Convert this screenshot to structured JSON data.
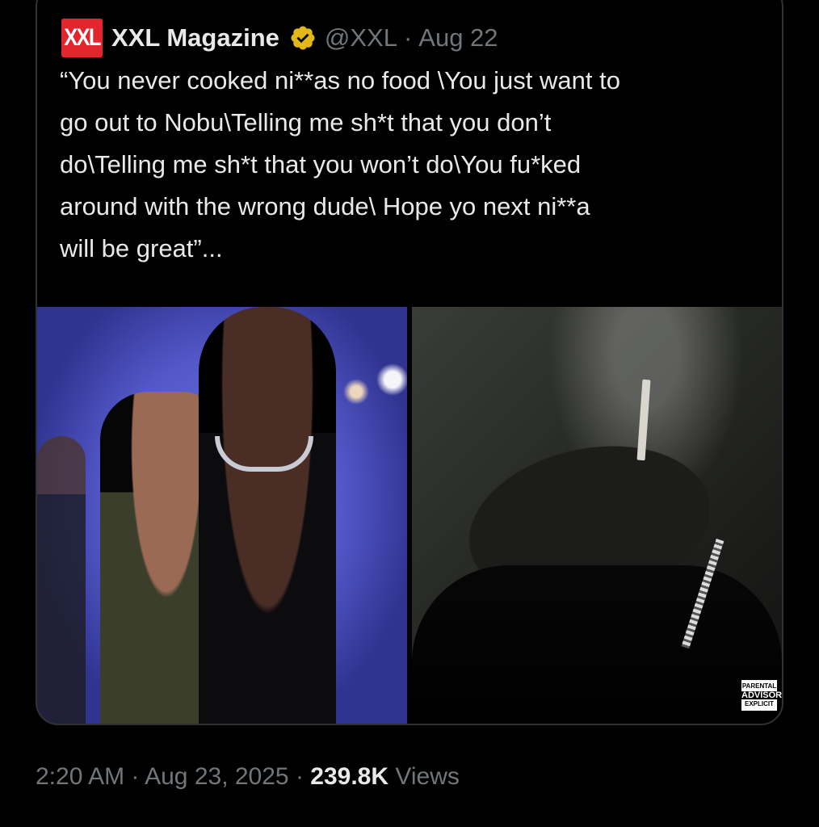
{
  "quote": {
    "logo_text": "XXL",
    "author_name": "XXL Magazine",
    "handle": "@XXL",
    "separator": "·",
    "date": "Aug 22",
    "text": "“You never cooked ni**as no food \\You just want to\ngo out to Nobu\\Telling me sh*t that you don’t\ndo\\Telling me sh*t that you won’t do\\You fu*ked\naround with the wrong dude\\ Hope yo next ni**a\nwill be great”...",
    "advisory": {
      "line1": "PARENTAL",
      "line2": "ADVISORY",
      "line3": "EXPLICIT"
    }
  },
  "meta": {
    "time": "2:20 AM",
    "sep1": "·",
    "date": "Aug 23, 2025",
    "sep2": "·",
    "views_count": "239.8K",
    "views_label": "Views"
  },
  "colors": {
    "verified_badge": "#e2b719",
    "logo_bg": "#e3262e",
    "secondary_text": "#71767b"
  },
  "icons": {
    "verified": "verified-badge-icon"
  }
}
